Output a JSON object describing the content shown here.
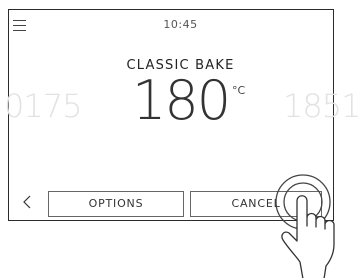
{
  "header": {
    "clock": "10:45",
    "menu_icon": "hamburger-menu-icon"
  },
  "program": {
    "title": "CLASSIC BAKE"
  },
  "temperature": {
    "prev_values": "0175",
    "value": "180",
    "unit": "°C",
    "next_values": "1851"
  },
  "footer": {
    "back_icon": "chevron-left-icon",
    "options_label": "OPTIONS",
    "cancel_label": "CANCEL"
  },
  "overlay": {
    "hand_icon": "pointing-hand-icon",
    "touch_indicator": "tap-rings"
  },
  "colors": {
    "text": "#333333",
    "faded_text": "#e2e2e2",
    "border": "#2b2b2b"
  }
}
